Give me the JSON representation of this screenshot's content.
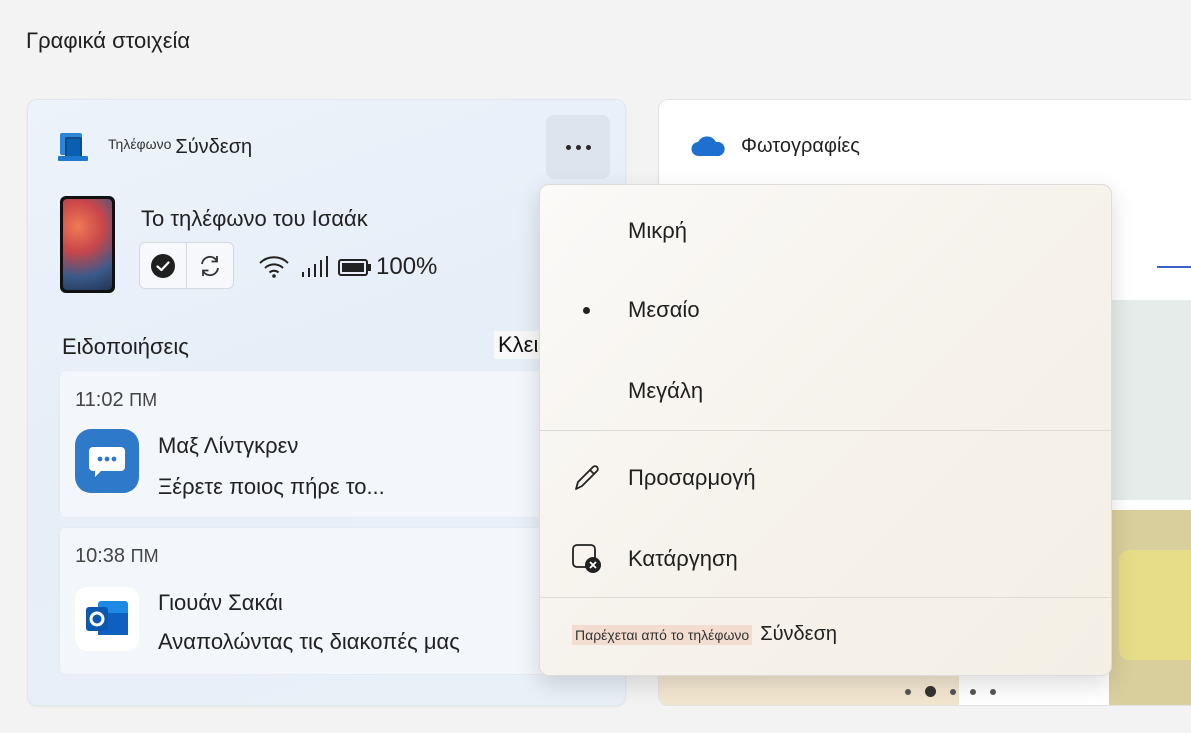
{
  "page": {
    "section_title": "Γραφικά στοιχεία"
  },
  "phone_widget": {
    "header_small": "Τηλέφωνο",
    "header_main": "Σύνδεση",
    "device_name": "Το τηλέφωνο του Ισαάκ",
    "battery": "100%",
    "notifications_title": "Ειδοποιήσεις",
    "notifications": [
      {
        "time": "11:02",
        "period": "ΠΜ",
        "sender": "Μαξ Λίντγκρεν",
        "message": "Ξέρετε ποιος πήρε το...",
        "app_icon": "messages-icon"
      },
      {
        "time": "10:38",
        "period": "ΠΜ",
        "sender": "Γιουάν Σακάι",
        "message": "Αναπολώντας τις διακοπές μας",
        "app_icon": "outlook-icon"
      }
    ]
  },
  "tooltip": {
    "text": "Κλειδί"
  },
  "photos_widget": {
    "title": "Φωτογραφίες",
    "pager_count": 5,
    "pager_active": 2
  },
  "context_menu": {
    "items": [
      {
        "label": "Μικρή",
        "selected": false
      },
      {
        "label": "Μεσαίο",
        "selected": true
      },
      {
        "label": "Μεγάλη",
        "selected": false
      }
    ],
    "actions": [
      {
        "label": "Προσαρμογή",
        "icon": "pencil-icon"
      },
      {
        "label": "Κατάργηση",
        "icon": "remove-widget-icon"
      }
    ],
    "footer_small": "Παρέχεται από το τηλέφωνο",
    "footer_main": "Σύνδεση"
  },
  "colors": {
    "accent": "#2e79c9",
    "onedrive": "#1e6fd0",
    "outlook": "#0f5fc1"
  }
}
